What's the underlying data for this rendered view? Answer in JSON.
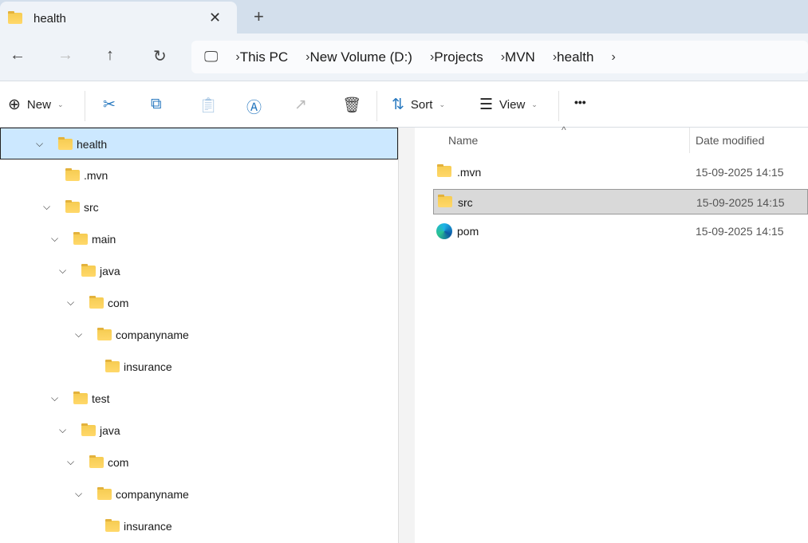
{
  "tab": {
    "title": "health",
    "close": "✕",
    "new_tab": "+"
  },
  "nav": {
    "back": "←",
    "forward": "→",
    "up": "↑",
    "refresh": "↻",
    "breadcrumb": [
      "This PC",
      "New Volume (D:)",
      "Projects",
      "MVN",
      "health"
    ]
  },
  "toolbar": {
    "new": "New",
    "sort": "Sort",
    "view": "View",
    "more": "•••"
  },
  "tree": [
    {
      "label": "health",
      "level": 0,
      "expanded": true,
      "selected": true
    },
    {
      "label": ".mvn",
      "level": 1,
      "expanded": null
    },
    {
      "label": "src",
      "level": 1,
      "expanded": true
    },
    {
      "label": "main",
      "level": 2,
      "expanded": true
    },
    {
      "label": "java",
      "level": 3,
      "expanded": true
    },
    {
      "label": "com",
      "level": 4,
      "expanded": true
    },
    {
      "label": "companyname",
      "level": 5,
      "expanded": true
    },
    {
      "label": "insurance",
      "level": 6,
      "expanded": null
    },
    {
      "label": "test",
      "level": 2,
      "expanded": true
    },
    {
      "label": "java",
      "level": 3,
      "expanded": true
    },
    {
      "label": "com",
      "level": 4,
      "expanded": true
    },
    {
      "label": "companyname",
      "level": 5,
      "expanded": true
    },
    {
      "label": "insurance",
      "level": 6,
      "expanded": null
    }
  ],
  "columns": {
    "name": "Name",
    "date": "Date modified"
  },
  "files": [
    {
      "name": ".mvn",
      "date": "15-09-2025 14:15",
      "type": "folder"
    },
    {
      "name": "src",
      "date": "15-09-2025 14:15",
      "type": "folder",
      "selected": true
    },
    {
      "name": "pom",
      "date": "15-09-2025 14:15",
      "type": "edge"
    }
  ]
}
